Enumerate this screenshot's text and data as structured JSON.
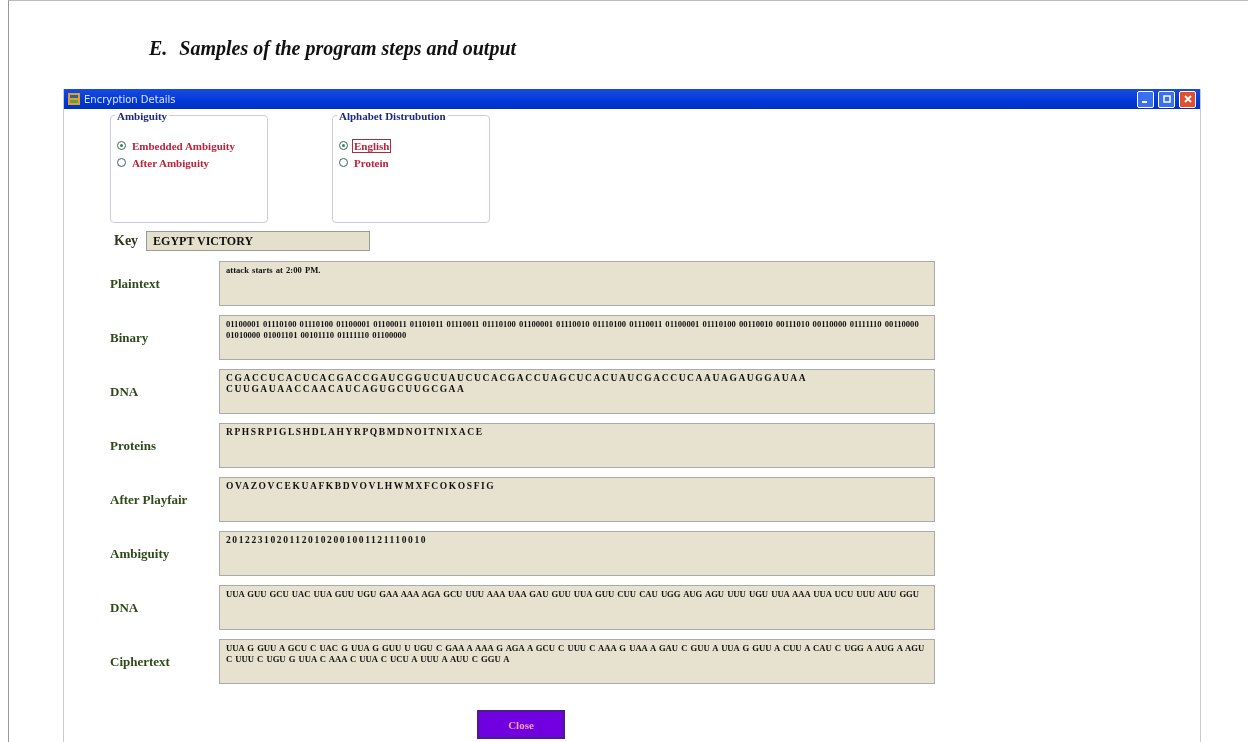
{
  "heading": {
    "number": "E.",
    "text": "Samples of the program steps and output"
  },
  "window": {
    "title": "Encryption Details"
  },
  "groups": [
    {
      "title": "Ambiguity",
      "options": [
        {
          "label": "Embedded Ambiguity",
          "selected": true,
          "focused": false
        },
        {
          "label": "After Ambiguity",
          "selected": false,
          "focused": false
        }
      ]
    },
    {
      "title": "Alphabet Distrubution",
      "options": [
        {
          "label": "English",
          "selected": true,
          "focused": true
        },
        {
          "label": "Protein",
          "selected": false,
          "focused": false
        }
      ]
    }
  ],
  "key": {
    "label": "Key",
    "value": "EGYPT VICTORY"
  },
  "rows": [
    {
      "label": "Plaintext",
      "kind": "plain",
      "value": "attack starts at 2:00 PM."
    },
    {
      "label": "Binary",
      "kind": "plain",
      "value": "01100001 01110100 01110100 01100001 01100011 01101011 01110011 01110100 01100001 01110010 01110100 01110011 01100001 01110100 00110010 00111010 00110000 01111110 00110000 01010000 01001101 00101110 01111110 01100000"
    },
    {
      "label": "DNA",
      "kind": "wide",
      "value": "CGACCUCACUCACGACCGAUCGGUCUAUCUCACGACCUAGCUCACUAUCGACCUCAAUAGAUGGAUAA CUUGAUAACCAACAUCAGUGCUUGCGAA"
    },
    {
      "label": "Proteins",
      "kind": "wide",
      "value": "RPHSRPIGLSHDLAHYRPQBMDNOITNIXACE"
    },
    {
      "label": "After Playfair",
      "kind": "wide",
      "value": "OVAZOVCEKUAFKBDVOVLHWMXFCOKOSFIG"
    },
    {
      "label": "Ambiguity",
      "kind": "wide",
      "value": "20122310201120102001001121110010"
    },
    {
      "label": "DNA",
      "kind": "plain",
      "value": "UUA GUU GCU UAC UUA GUU UGU GAA AAA AGA GCU UUU AAA UAA GAU GUU UUA GUU CUU CAU UGG AUG AGU UUU UGU UUA AAA UUA UCU UUU AUU GGU"
    },
    {
      "label": "Ciphertext",
      "kind": "plain",
      "value": "UUA G GUU A GCU C UAC G UUA G GUU U UGU C GAA A AAA G AGA A GCU C UUU C AAA G UAA A GAU C GUU A UUA G GUU A CUU A CAU C UGG A AUG A AGU C UUU C UGU G UUA C AAA C UUA C UCU A UUU A AUU C GGU A"
    }
  ],
  "close_button": "Close"
}
